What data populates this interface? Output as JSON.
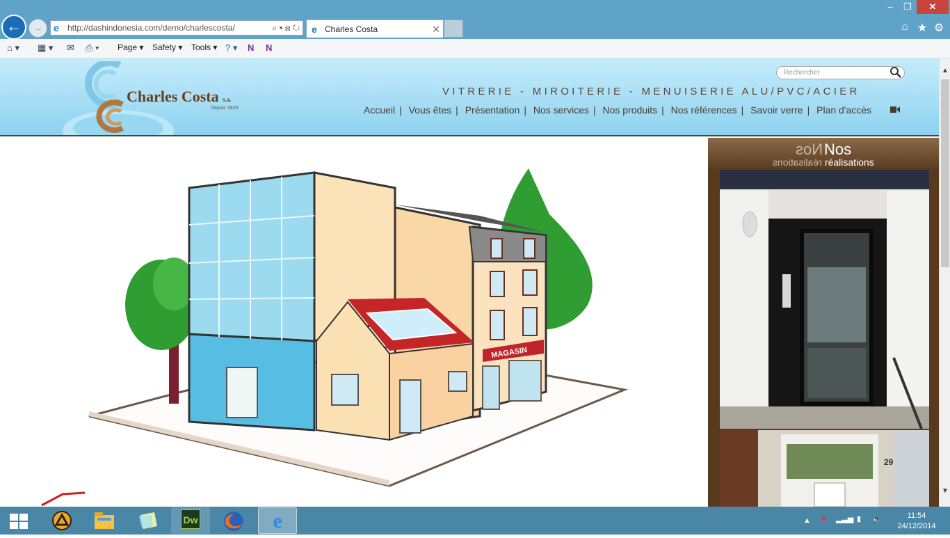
{
  "browser": {
    "url": "http://dashindonesia.com/demo/charlescosta/",
    "tab_title": "Charles Costa",
    "window_controls": {
      "minimize": "–",
      "maximize": "❐",
      "close": "✕"
    },
    "command_bar": {
      "page_label": "Page",
      "safety_label": "Safety",
      "tools_label": "Tools"
    }
  },
  "site": {
    "logo_name": "Charles Costa",
    "logo_suffix": "s.a.",
    "logo_since": "Depuis 1920",
    "search_placeholder": "Rechercher",
    "tagline": "VITRERIE - MIROITERIE - MENUISERIE ALU/PVC/ACIER",
    "nav": [
      "Accueil",
      "Vous êtes",
      "Présentation",
      "Nos services",
      "Nos produits",
      "Nos références",
      "Savoir verre",
      "Plan d'accès"
    ],
    "illustration_sign": "MAGASIN",
    "sidebar_title": "Nos",
    "sidebar_subtitle": "réalisations",
    "photo2_number": "29"
  },
  "taskbar": {
    "time": "11:54",
    "date": "24/12/2014",
    "dw_label": "Dw"
  },
  "colors": {
    "ie_frame": "#5fa3c9",
    "header_top": "#c5ecfb",
    "header_bottom": "#8ed2f0",
    "brand_brown": "#6b3f1a",
    "sidebar_brown": "#5a3a1f",
    "taskbar": "#4a87a7"
  }
}
